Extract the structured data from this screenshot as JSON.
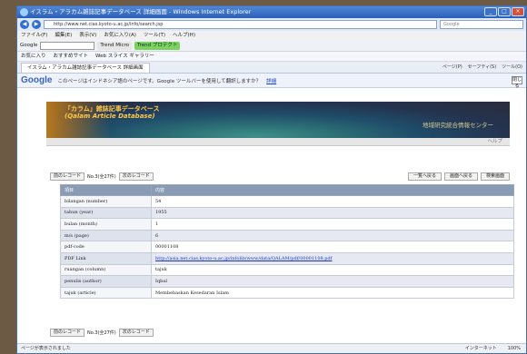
{
  "window": {
    "title": "イスラム・アラカム雑誌記事データベース 詳細画面 - Windows Internet Explorer",
    "url": "http://www.net.cias.kyoto-u.ac.jp/info/search.jsp",
    "search_placeholder": "Google"
  },
  "menubar": [
    "ファイル(F)",
    "編集(E)",
    "表示(V)",
    "お気に入り(A)",
    "ツール(T)",
    "ヘルプ(H)"
  ],
  "googlebar": {
    "label": "Google",
    "pill1": "Trend Micro",
    "pill2": "Trend プロテクト"
  },
  "favorites": {
    "label": "お気に入り",
    "items": [
      "おすすめサイト",
      "Web スライス ギャラリー"
    ]
  },
  "tab": {
    "label": "イスラム・アラカム雑誌記事データベース 詳細画面"
  },
  "tabtools": [
    "ページ(P)",
    "セーフティ(S)",
    "ツール(O)"
  ],
  "translate": {
    "logo": "Google",
    "message": "このページはインドネシア語のページです。Google ツールバーを使用して翻訳しますか？",
    "link": "詳細",
    "close": "閉じる"
  },
  "banner": {
    "title_jp": "「カラム」雑誌記事データベース",
    "title_en": "(Qalam Article Database)",
    "org": "地域研究統合情報センター"
  },
  "help": "ヘルプ",
  "record_nav": {
    "prev": "前のレコード",
    "position": "No.3(全27件)",
    "next": "次のレコード"
  },
  "actions": [
    "一覧へ戻る",
    "画面へ戻る",
    "検索画面"
  ],
  "table": {
    "headers": [
      "項目",
      "内容"
    ],
    "rows": [
      {
        "field": "bilangan (number)",
        "value": "54"
      },
      {
        "field": "tahun (year)",
        "value": "1955"
      },
      {
        "field": "bulan (month)",
        "value": "1"
      },
      {
        "field": "m/s (page)",
        "value": "6"
      },
      {
        "field": "pdf-code",
        "value": "00001108"
      },
      {
        "field": "PDF Link",
        "value": "http://asia.net.cias.kyoto-u.ac.jp/infolib/www/data/QALAM/pdf/00001108.pdf",
        "is_link": true
      },
      {
        "field": "ruangan (column)",
        "value": "tajuk"
      },
      {
        "field": "penulis (author)",
        "value": "Iqbal"
      },
      {
        "field": "tajuk (article)",
        "value": "Membebaskan Kesedaran Islam"
      }
    ]
  },
  "status": {
    "left": "ページが表示されました",
    "zone": "インターネット",
    "zoom": "100%"
  }
}
